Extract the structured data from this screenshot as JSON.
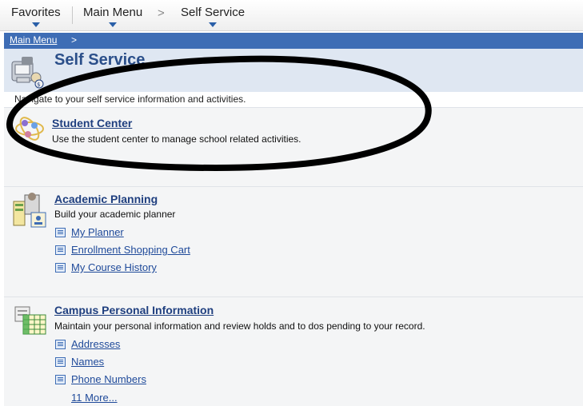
{
  "topbar": {
    "favorites": "Favorites",
    "main_menu": "Main Menu",
    "self_service": "Self Service",
    "chevron": ">"
  },
  "breadcrumb": {
    "main_menu": "Main Menu",
    "separator": ">"
  },
  "page": {
    "title": "Self Service",
    "description": "Navigate to your self service information and activities."
  },
  "student_center": {
    "title": "Student Center",
    "description": "Use the student center to manage school related activities."
  },
  "academic_planning": {
    "title": "Academic Planning",
    "description": "Build your academic planner",
    "links": [
      "My Planner",
      "Enrollment Shopping Cart",
      "My Course History"
    ]
  },
  "campus_personal": {
    "title": "Campus Personal Information",
    "description": "Maintain your personal information and review holds and to dos pending to your record.",
    "links": [
      "Addresses",
      "Names",
      "Phone Numbers"
    ],
    "more": "11 More..."
  },
  "colors": {
    "accent": "#3e6db5",
    "link": "#1f3f7f",
    "header_bg": "#dfe7f2",
    "annotation": "#000000"
  }
}
